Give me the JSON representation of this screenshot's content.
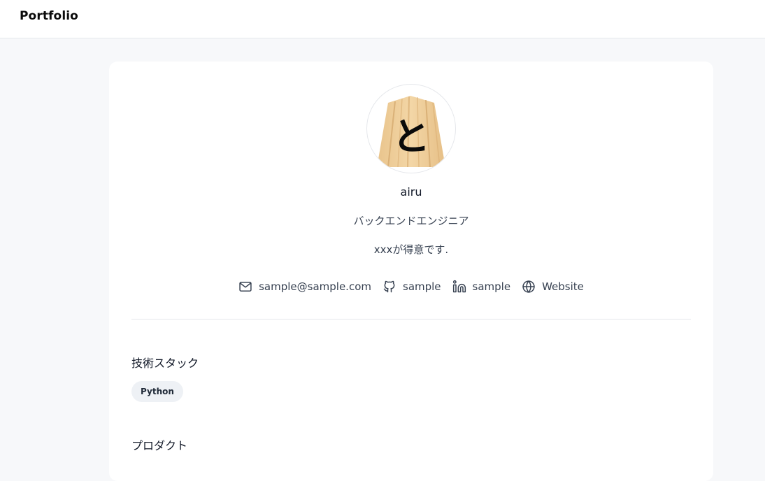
{
  "header": {
    "brand": "Portfolio"
  },
  "profile": {
    "avatar_glyph": "と",
    "name": "airu",
    "role": "バックエンドエンジニア",
    "bio": "xxxが得意です."
  },
  "links": [
    {
      "icon": "mail-icon",
      "label": "sample@sample.com"
    },
    {
      "icon": "github-icon",
      "label": "sample"
    },
    {
      "icon": "linkedin-icon",
      "label": "sample"
    },
    {
      "icon": "globe-icon",
      "label": "Website"
    }
  ],
  "sections": {
    "tech_stack": {
      "title": "技術スタック",
      "items": [
        "Python"
      ]
    },
    "products": {
      "title": "プロダクト"
    }
  },
  "colors": {
    "page_bg": "#f7f8fa",
    "card_bg": "#ffffff",
    "chip_bg": "#eef1f5",
    "text_muted": "#374151"
  }
}
